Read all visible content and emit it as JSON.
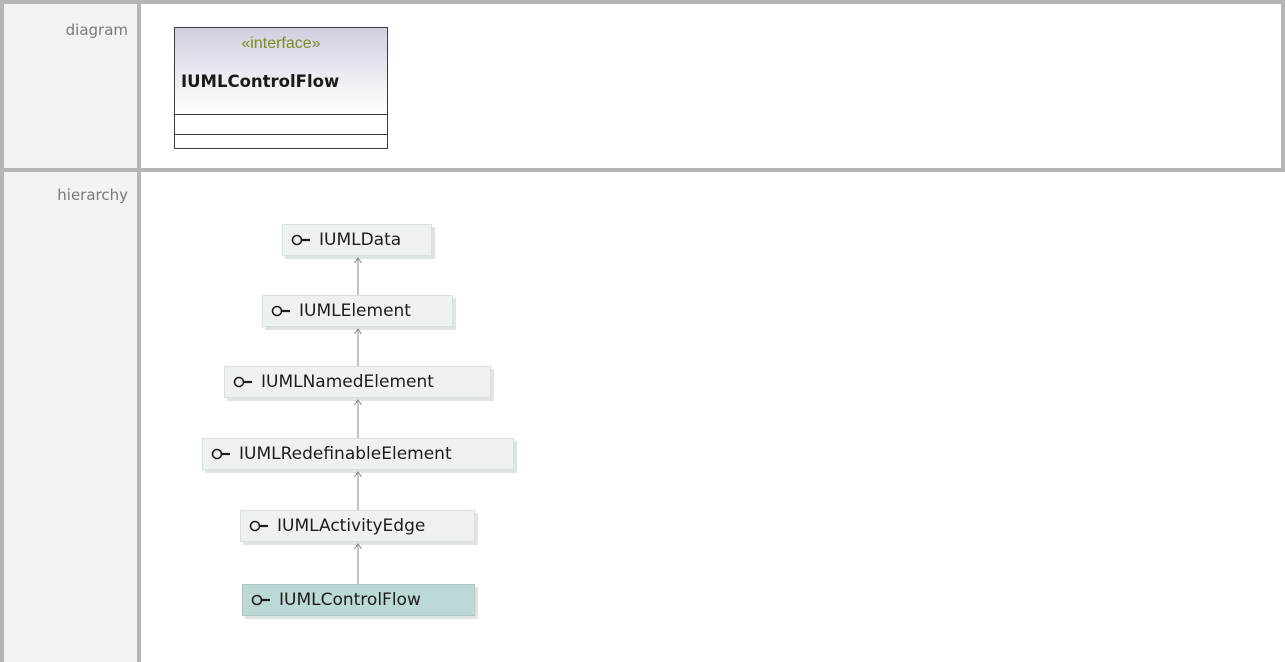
{
  "rows": {
    "diagram_label": "diagram",
    "hierarchy_label": "hierarchy"
  },
  "interface_box": {
    "stereotype": "«interface»",
    "name": "IUMLControlFlow"
  },
  "hierarchy": {
    "nodes": [
      {
        "name": "IUMLData",
        "current": false
      },
      {
        "name": "IUMLElement",
        "current": false
      },
      {
        "name": "IUMLNamedElement",
        "current": false
      },
      {
        "name": "IUMLRedefinableElement",
        "current": false
      },
      {
        "name": "IUMLActivityEdge",
        "current": false
      },
      {
        "name": "IUMLControlFlow",
        "current": true
      }
    ]
  },
  "colors": {
    "border": "#b5b5b5",
    "label_background": "#f2f2f2",
    "label_text": "#7a7a7a",
    "stereotype_text": "#7f8a1c",
    "node_background": "#edf2f0",
    "current_node_background": "#bcd9d7"
  },
  "icons": {
    "interface_icon": "lollipop-interface-icon",
    "generalization_arrow": "hollow-arrow-up"
  }
}
